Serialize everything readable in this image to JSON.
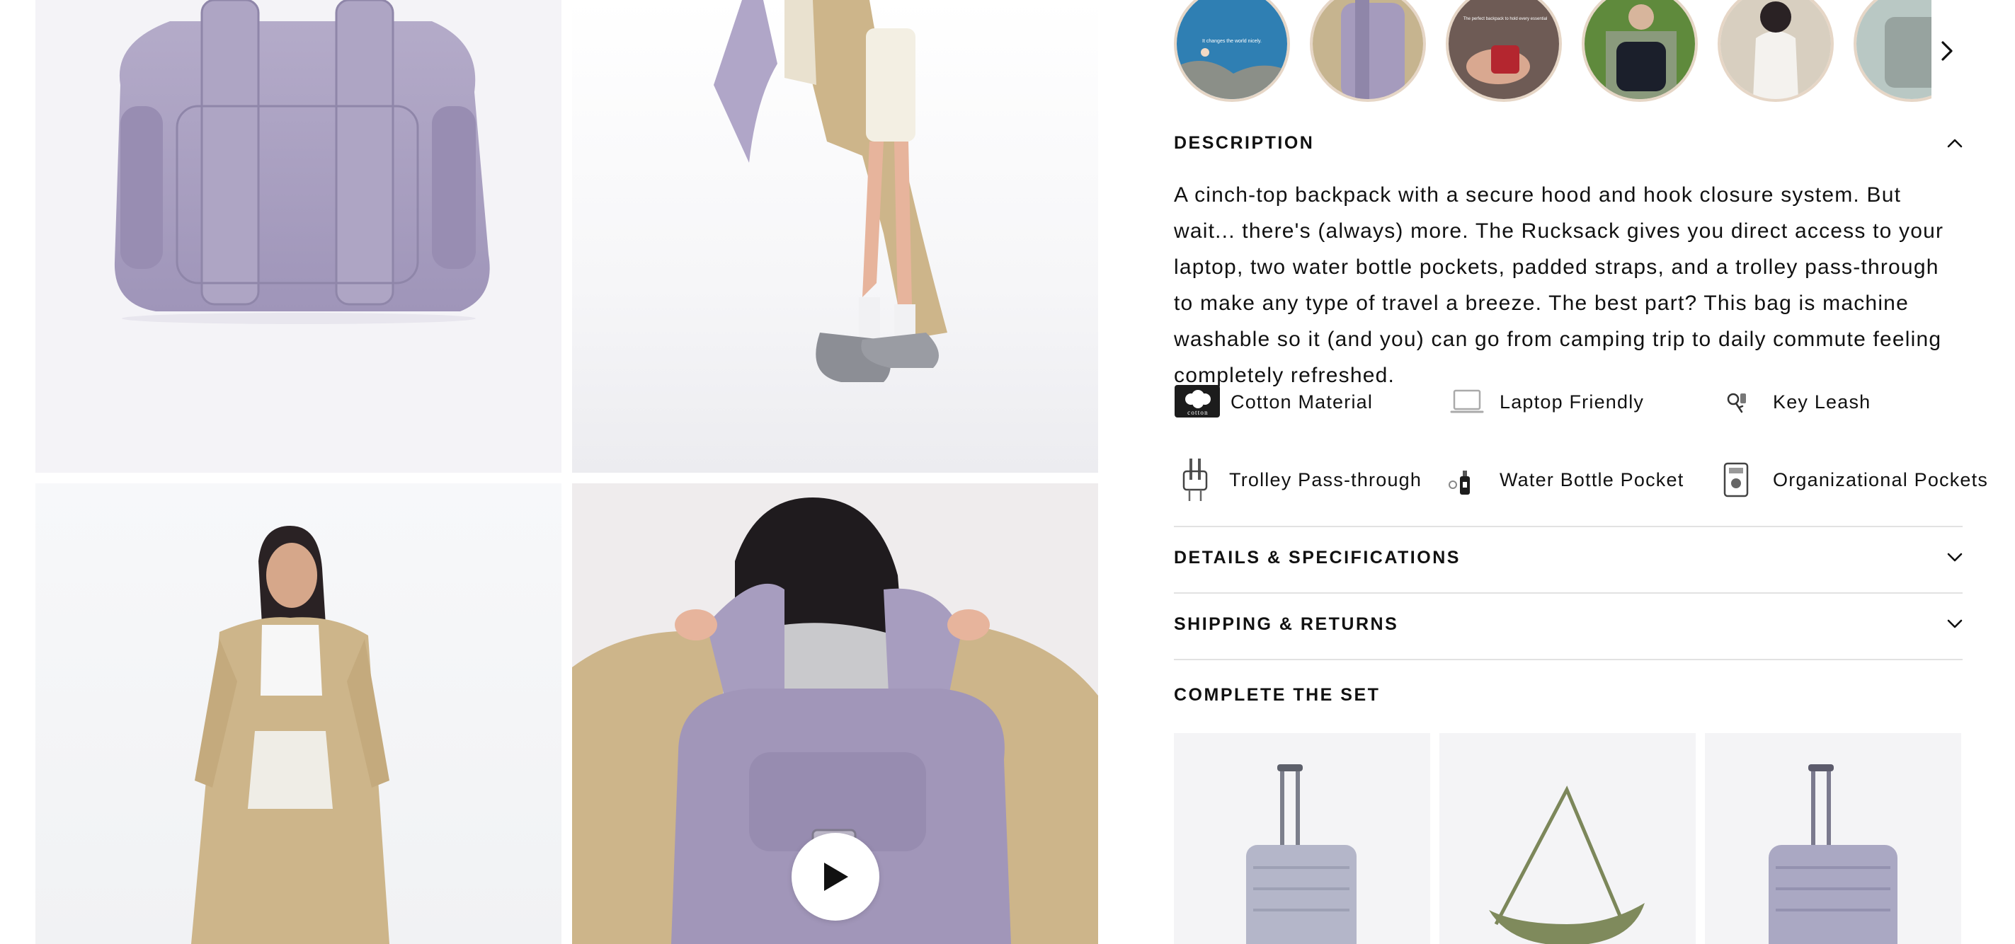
{
  "gallery": {
    "images": [
      {
        "name": "backpack-back-view"
      },
      {
        "name": "model-side-view"
      },
      {
        "name": "model-front-view"
      },
      {
        "name": "model-wearing-backpack-video"
      }
    ],
    "play_icon": "play-icon"
  },
  "thumbnails": {
    "items": [
      {
        "name": "thumb-lake",
        "overlay": "It changes the world nicely."
      },
      {
        "name": "thumb-backpack-detail",
        "overlay": ""
      },
      {
        "name": "thumb-hands",
        "overlay": "The perfect backpack to hold every essential"
      },
      {
        "name": "thumb-plaid-shirt",
        "overlay": ""
      },
      {
        "name": "thumb-white-top",
        "overlay": ""
      },
      {
        "name": "thumb-partial",
        "overlay": ""
      }
    ],
    "next_icon": "chevron-right-icon"
  },
  "description": {
    "title": "DESCRIPTION",
    "text": "A cinch-top backpack with a secure hood and hook closure system. But wait... there's (always) more. The Rucksack gives you direct access to your laptop, two water bottle pockets, padded straps, and a trolley pass-through to make any type of travel a breeze. The best part? This bag is machine washable so it (and you) can go from camping trip to daily commute feeling completely refreshed.",
    "toggle_icon": "chevron-up-icon"
  },
  "features": [
    {
      "label": "Cotton Material",
      "icon": "cotton-icon",
      "badge": "cotton"
    },
    {
      "label": "Laptop Friendly",
      "icon": "laptop-icon"
    },
    {
      "label": "Key Leash",
      "icon": "key-leash-icon"
    },
    {
      "label": "Trolley Pass-through",
      "icon": "trolley-icon"
    },
    {
      "label": "Water Bottle Pocket",
      "icon": "water-bottle-icon"
    },
    {
      "label": "Organizational Pockets",
      "icon": "organizational-pockets-icon"
    }
  ],
  "details": {
    "title": "DETAILS & SPECIFICATIONS",
    "toggle_icon": "chevron-down-icon"
  },
  "shipping": {
    "title": "SHIPPING & RETURNS",
    "toggle_icon": "chevron-down-icon"
  },
  "complete_set": {
    "title": "COMPLETE THE SET",
    "products": [
      {
        "name": "carry-on-suitcase",
        "color": "#aeb0c4"
      },
      {
        "name": "shoulder-bag",
        "color": "#7f8a5c"
      },
      {
        "name": "large-suitcase",
        "color": "#a9a8c2"
      }
    ]
  },
  "colors": {
    "lavender": "#a79dbf",
    "trench": "#cdb58a",
    "thumb_ring": "#e6d6c6",
    "divider": "#e2e2e2"
  }
}
